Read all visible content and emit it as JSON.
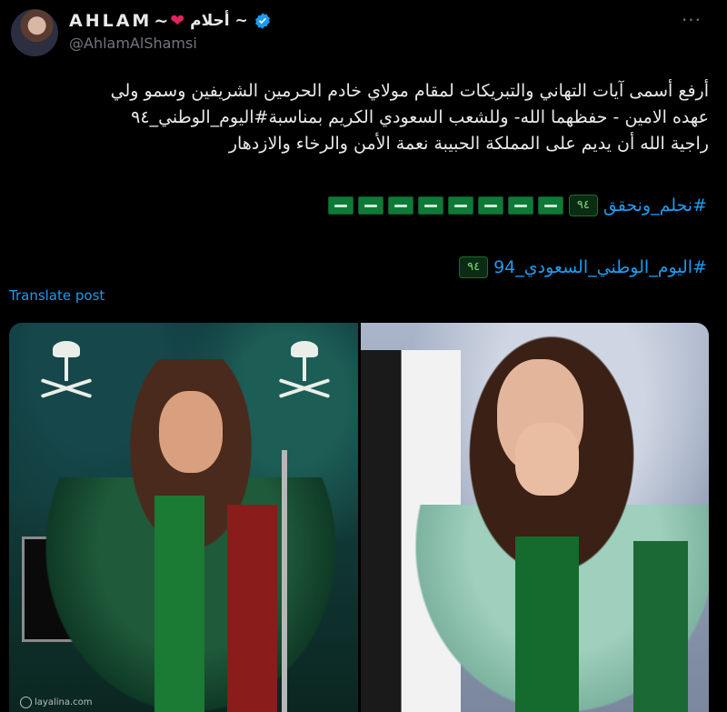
{
  "author": {
    "display_name": "AHLAM",
    "name_suffix": "~",
    "arabic_name": "~ أحلام",
    "handle": "@AhlamAlShamsi"
  },
  "post": {
    "text_lines": [
      "أرفع أسمى آيات التهاني والتبريكات لمقام مولاي خادم الحرمين الشريفين وسمو ولي",
      "عهده الامين - حفظهما الله- وللشعب السعودي الكريم بمناسبة#اليوم_الوطني_٩٤",
      "راجية الله أن يديم على المملكة الحبيبة نعمة الأمن والرخاء والازدهار"
    ],
    "hashtag_1": "#نحلم_ونحقق",
    "hashtag_1_badge": "٩٤",
    "flags_count": 8,
    "hashtag_2": "#اليوم_الوطني_السعودي_94",
    "hashtag_2_badge": "٩٤",
    "translate_label": "Translate post"
  },
  "media": {
    "watermark": "layalina.com"
  },
  "colors": {
    "background": "#000000",
    "text": "#e7e9ea",
    "muted": "#71767b",
    "link": "#1d9bf0",
    "verified": "#1d9bf0",
    "heart": "#e0245e"
  },
  "icons": {
    "more": "more-horizontal-icon",
    "verified": "verified-badge-icon",
    "heart": "heart-emoji-icon",
    "flag": "saudi-flag-emoji-icon"
  }
}
